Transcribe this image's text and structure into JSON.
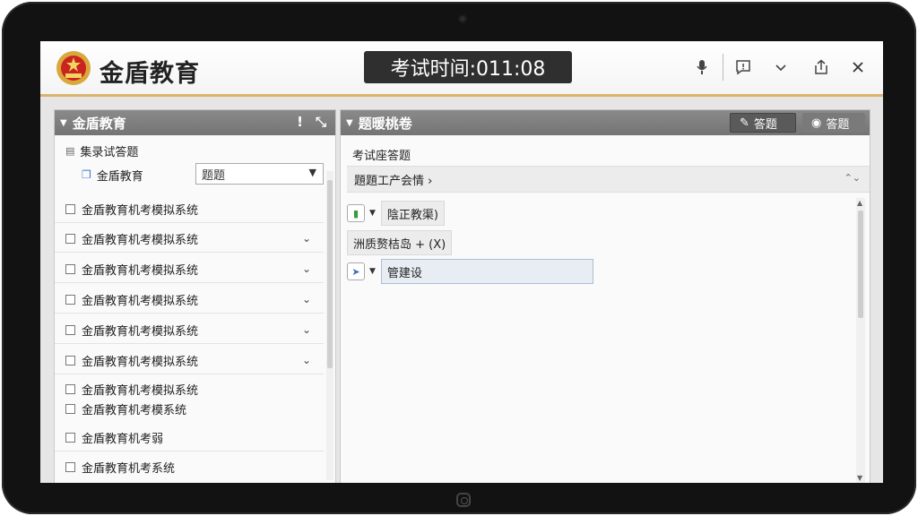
{
  "app": {
    "title": "金盾教育",
    "timer": "考试时间:011:08"
  },
  "left_panel": {
    "title": "金盾教育",
    "tree_root": "集录试答题",
    "tree_child": "金盾教育",
    "select_value": "题题",
    "items": [
      "金盾教育机考模拟系统",
      "金盾教育机考模拟系统",
      "金盾教育机考模拟系统",
      "金盾教育机考模拟系统",
      "金盾教育机考模拟系统",
      "金盾教育机考模拟系统",
      "金盾教育机考模拟系统",
      "金盾教育机考模系统",
      "金盾教育机考弱",
      "金盾教育机考系统"
    ]
  },
  "right_panel": {
    "title": "题暖桃卷",
    "tab_active": "答题",
    "tab_inactive": "答题",
    "label": "考试座答题",
    "breadcrumb": "題題工产会情 ›",
    "nodes": [
      "陰正教渠)",
      "洲质赘桔岛 + (X)",
      "管建设"
    ]
  },
  "colors": {
    "accent": "#d9b46e",
    "header_gray": "#7f7f7f",
    "timer_bg": "#2f2f2f"
  }
}
